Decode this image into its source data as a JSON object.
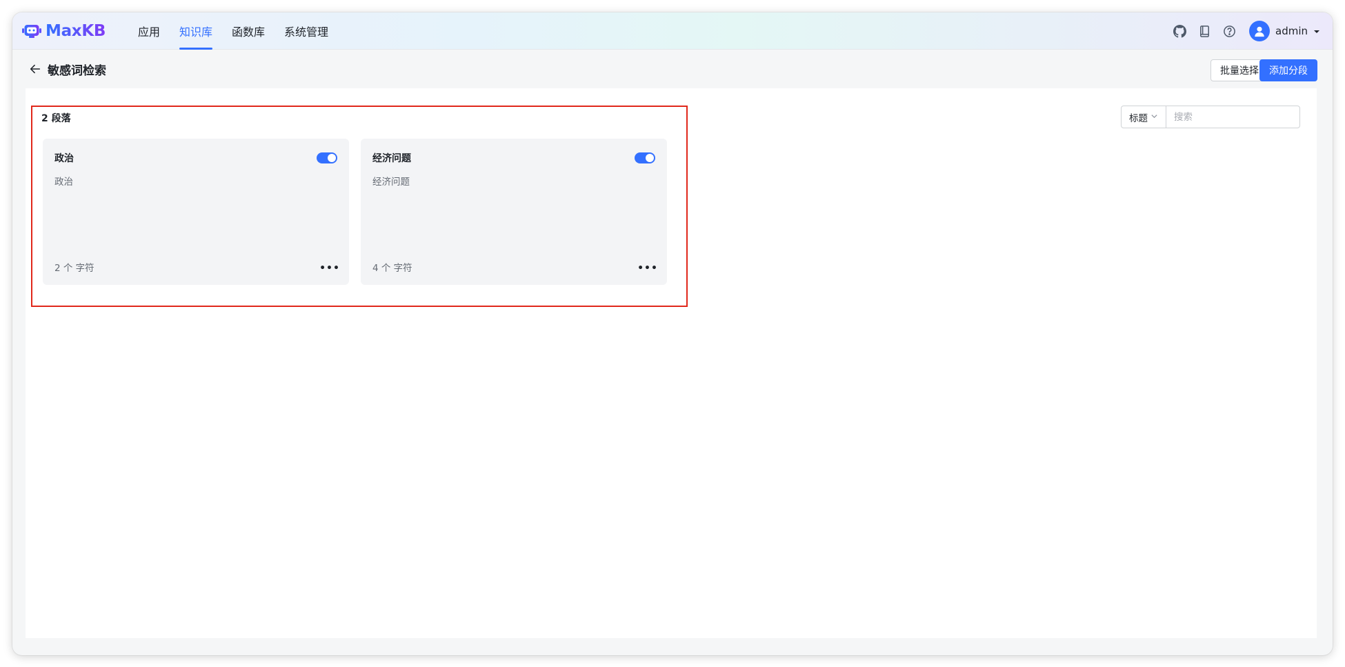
{
  "app": {
    "logo_text": "MaxKB",
    "nav": [
      {
        "label": "应用",
        "active": false
      },
      {
        "label": "知识库",
        "active": true
      },
      {
        "label": "函数库",
        "active": false
      },
      {
        "label": "系统管理",
        "active": false
      }
    ],
    "icons": [
      "github-icon",
      "docs-icon",
      "help-icon"
    ],
    "user": {
      "name": "admin"
    }
  },
  "page": {
    "title": "敏感词检索",
    "batch_select_label": "批量选择",
    "add_segment_label": "添加分段",
    "count_label": "2 段落"
  },
  "search": {
    "select_value": "标题",
    "placeholder": "搜索"
  },
  "segments": [
    {
      "title": "政治",
      "content": "政治",
      "chars": "2 个 字符",
      "enabled": true
    },
    {
      "title": "经济问题",
      "content": "经济问题",
      "chars": "4 个 字符",
      "enabled": true
    }
  ],
  "colors": {
    "primary": "#3370ff",
    "highlight": "#e0271a"
  }
}
